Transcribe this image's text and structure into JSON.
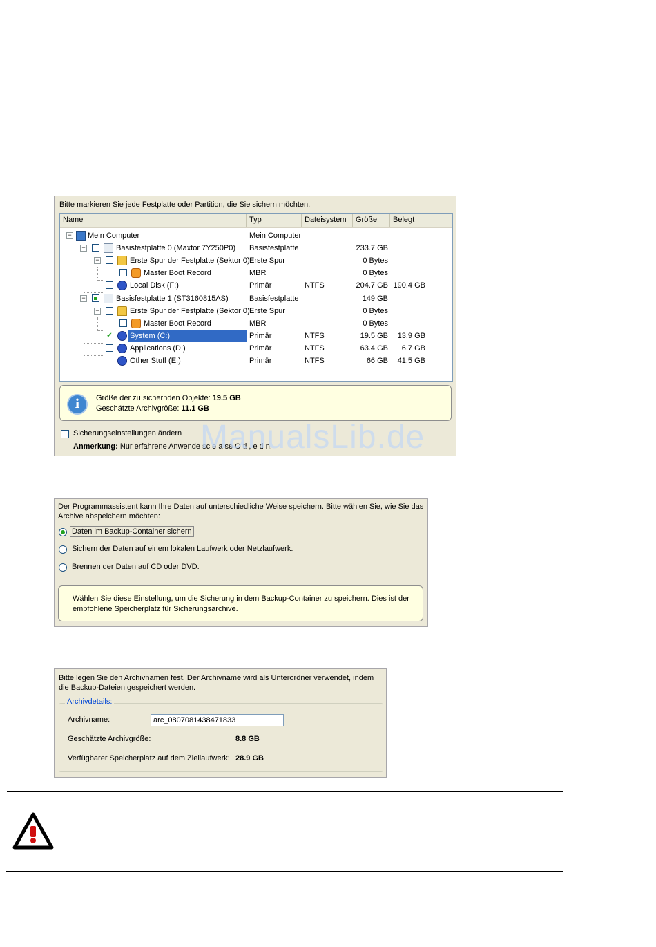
{
  "watermark": "ManualsLib.de",
  "backup_selection": {
    "prompt": "Bitte markieren Sie jede Festplatte oder Partition, die Sie sichern möchten.",
    "columns": [
      "Name",
      "Typ",
      "Dateisystem",
      "Größe",
      "Belegt"
    ],
    "rows": [
      {
        "name": "Mein Computer",
        "typ": "Mein Computer",
        "fs": "",
        "size": "",
        "used": ""
      },
      {
        "name": "Basisfestplatte 0 (Maxtor 7Y250P0)",
        "typ": "Basisfestplatte",
        "fs": "",
        "size": "233.7 GB",
        "used": ""
      },
      {
        "name": "Erste Spur der Festplatte (Sektor 0)",
        "typ": "Erste Spur",
        "fs": "",
        "size": "0 Bytes",
        "used": ""
      },
      {
        "name": "Master Boot Record",
        "typ": "MBR",
        "fs": "",
        "size": "0 Bytes",
        "used": ""
      },
      {
        "name": "Local Disk (F:)",
        "typ": "Primär",
        "fs": "NTFS",
        "size": "204.7 GB",
        "used": "190.4 GB"
      },
      {
        "name": "Basisfestplatte 1 (ST3160815AS)",
        "typ": "Basisfestplatte",
        "fs": "",
        "size": "149 GB",
        "used": ""
      },
      {
        "name": "Erste Spur der Festplatte (Sektor 0)",
        "typ": "Erste Spur",
        "fs": "",
        "size": "0 Bytes",
        "used": ""
      },
      {
        "name": "Master Boot Record",
        "typ": "MBR",
        "fs": "",
        "size": "0 Bytes",
        "used": ""
      },
      {
        "name": "System (C:)",
        "typ": "Primär",
        "fs": "NTFS",
        "size": "19.5 GB",
        "used": "13.9 GB"
      },
      {
        "name": "Applications (D:)",
        "typ": "Primär",
        "fs": "NTFS",
        "size": "63.4 GB",
        "used": "6.7 GB"
      },
      {
        "name": "Other Stuff (E:)",
        "typ": "Primär",
        "fs": "NTFS",
        "size": "66 GB",
        "used": "41.5 GB"
      }
    ],
    "info_size_label": "Größe der zu sichernden Objekte:",
    "info_size_value": "19.5 GB",
    "info_archive_label": "Geschätzte Archivgröße:",
    "info_archive_value": "11.1 GB",
    "change_settings_label": "Sicherungseinstellungen ändern",
    "note_label": "Anmerkung:",
    "note_text": "Nur erfahrene Anwende sc e  a  se  O  ti  , e  d  n."
  },
  "storage_method": {
    "prompt": "Der Programmassistent kann Ihre Daten auf unterschiedliche Weise speichern. Bitte wählen Sie, wie Sie das Archive abspeichern möchten:",
    "options": [
      "Daten im Backup-Container sichern",
      "Sichern der Daten auf einem lokalen Laufwerk oder Netzlaufwerk.",
      "Brennen der Daten auf CD oder DVD."
    ],
    "selected_option": "Daten im Backup-Container sichern",
    "hint": "Wählen Sie diese Einstellung, um die Sicherung in dem Backup-Container zu speichern. Dies ist der empfohlene Speicherplatz für Sicherungsarchive."
  },
  "archive_name": {
    "prompt": "Bitte legen Sie den Archivnamen fest. Der Archivname wird als Unterordner verwendet, indem die Backup-Dateien gespeichert werden.",
    "group_title": "Archivdetails:",
    "name_label": "Archivname:",
    "name_value": "arc_08070814384718​33",
    "size_label": "Geschätzte Archivgröße:",
    "size_value": "8.8 GB",
    "free_label": "Verfügbarer Speicherplatz auf dem Ziellaufwerk:",
    "free_value": "28.9 GB"
  },
  "icons": [
    "computer-icon",
    "disk-icon",
    "first-track-icon",
    "mbr-icon",
    "partition-icon",
    "info-icon",
    "warning-icon"
  ],
  "colors": {
    "selection": "#316ac5",
    "info_background": "#ffffe1",
    "check": "#21a121",
    "warning": "#d01010"
  }
}
